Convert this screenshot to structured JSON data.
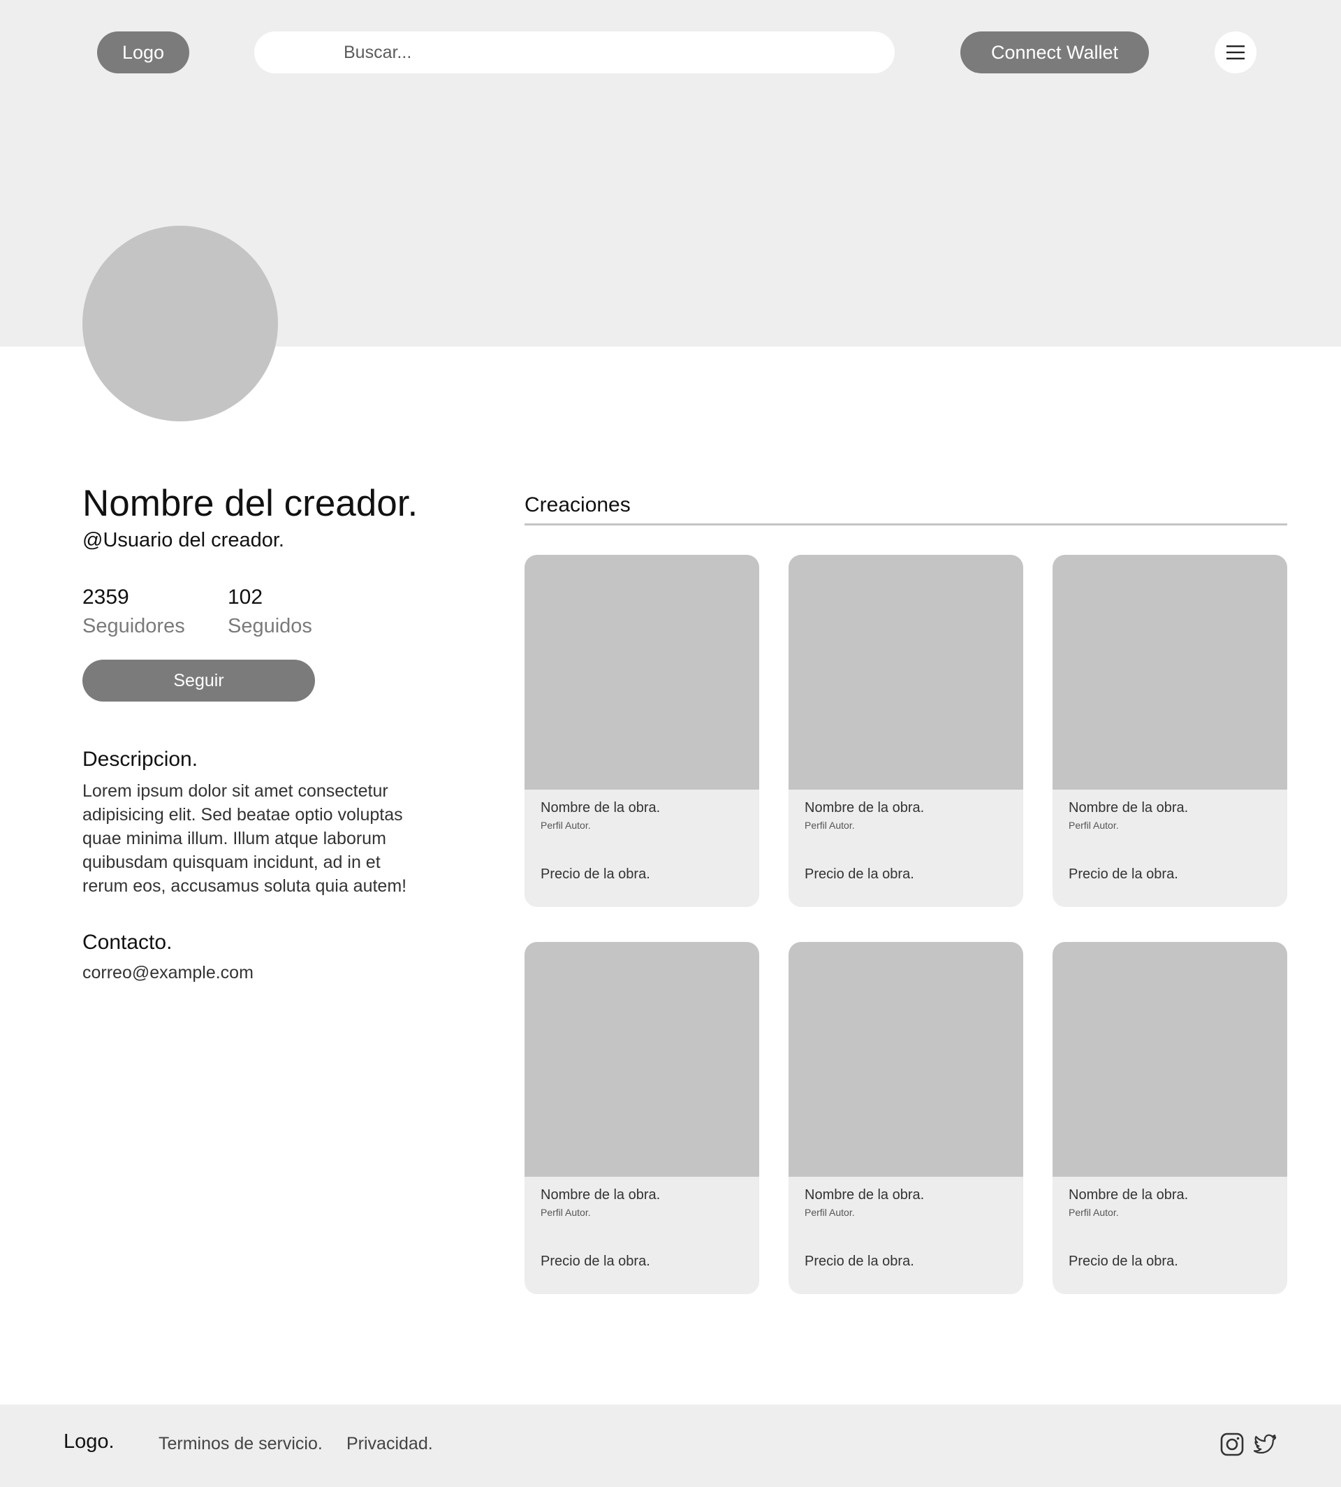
{
  "header": {
    "logo_label": "Logo",
    "search_placeholder": "Buscar...",
    "wallet_label": "Connect Wallet",
    "menu_icon": "hamburger-menu-icon"
  },
  "profile": {
    "name": "Nombre del creador.",
    "username": "@Usuario del creador.",
    "stats": [
      {
        "value": "2359",
        "label": "Seguidores"
      },
      {
        "value": "102",
        "label": "Seguidos"
      }
    ],
    "follow_label": "Seguir",
    "description_title": "Descripcion.",
    "description_text": "Lorem ipsum dolor sit amet consectetur adipisicing elit. Sed beatae optio voluptas quae minima illum. Illum atque laborum quibusdam quisquam incidunt, ad in et rerum eos, accusamus soluta quia autem!",
    "contact_title": "Contacto.",
    "contact_email": "correo@example.com"
  },
  "creations": {
    "tab_label": "Creaciones",
    "cards": [
      {
        "title": "Nombre de la obra.",
        "author": "Perfil Autor.",
        "price": "Precio de la obra."
      },
      {
        "title": "Nombre de la obra.",
        "author": "Perfil Autor.",
        "price": "Precio de la obra."
      },
      {
        "title": "Nombre de la obra.",
        "author": "Perfil Autor.",
        "price": "Precio de la obra."
      },
      {
        "title": "Nombre de la obra.",
        "author": "Perfil Autor.",
        "price": "Precio de la obra."
      },
      {
        "title": "Nombre de la obra.",
        "author": "Perfil Autor.",
        "price": "Precio de la obra."
      },
      {
        "title": "Nombre de la obra.",
        "author": "Perfil Autor.",
        "price": "Precio de la obra."
      }
    ]
  },
  "footer": {
    "logo_label": "Logo.",
    "links": [
      "Terminos de servicio.",
      "Privacidad."
    ],
    "social_icons": [
      "instagram-icon",
      "twitter-icon"
    ]
  },
  "colors": {
    "banner_bg": "#eeeeee",
    "pill_bg": "#7b7b7b",
    "placeholder_gray": "#c4c4c4",
    "card_bg": "#eeedee"
  }
}
